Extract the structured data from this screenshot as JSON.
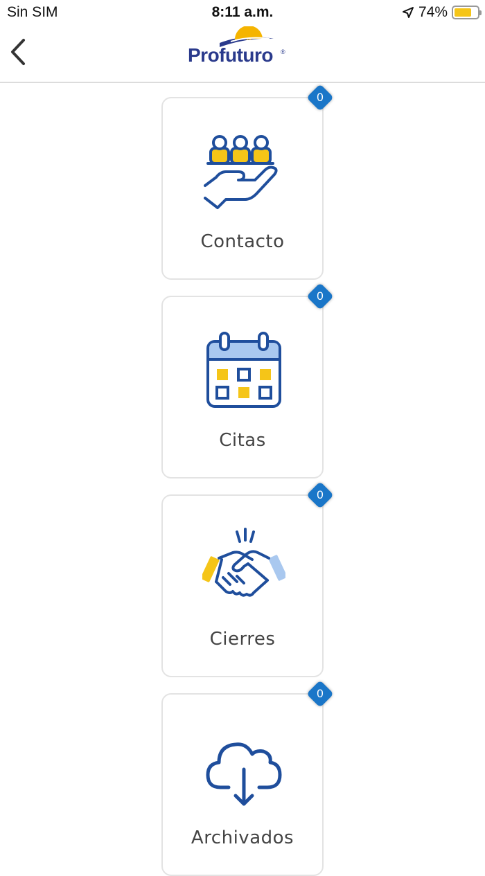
{
  "status_bar": {
    "carrier": "Sin SIM",
    "time": "8:11 a.m.",
    "battery": "74%",
    "battery_level": 0.74,
    "location_icon": "location-arrow-icon"
  },
  "header": {
    "logo_text": "Profuturo",
    "logo_mark": "®",
    "back_icon": "chevron-left-icon"
  },
  "colors": {
    "brand_blue": "#2a3a8c",
    "icon_blue": "#1f4e9c",
    "accent_yellow": "#f5c518",
    "light_blue": "#a9c8ef",
    "badge_blue": "#1a76c8"
  },
  "cards": [
    {
      "label": "Contacto",
      "badge": "0",
      "icon": "people-in-hand-icon"
    },
    {
      "label": "Citas",
      "badge": "0",
      "icon": "calendar-icon"
    },
    {
      "label": "Cierres",
      "badge": "0",
      "icon": "handshake-icon"
    },
    {
      "label": "Archivados",
      "badge": "0",
      "icon": "cloud-download-icon"
    }
  ]
}
